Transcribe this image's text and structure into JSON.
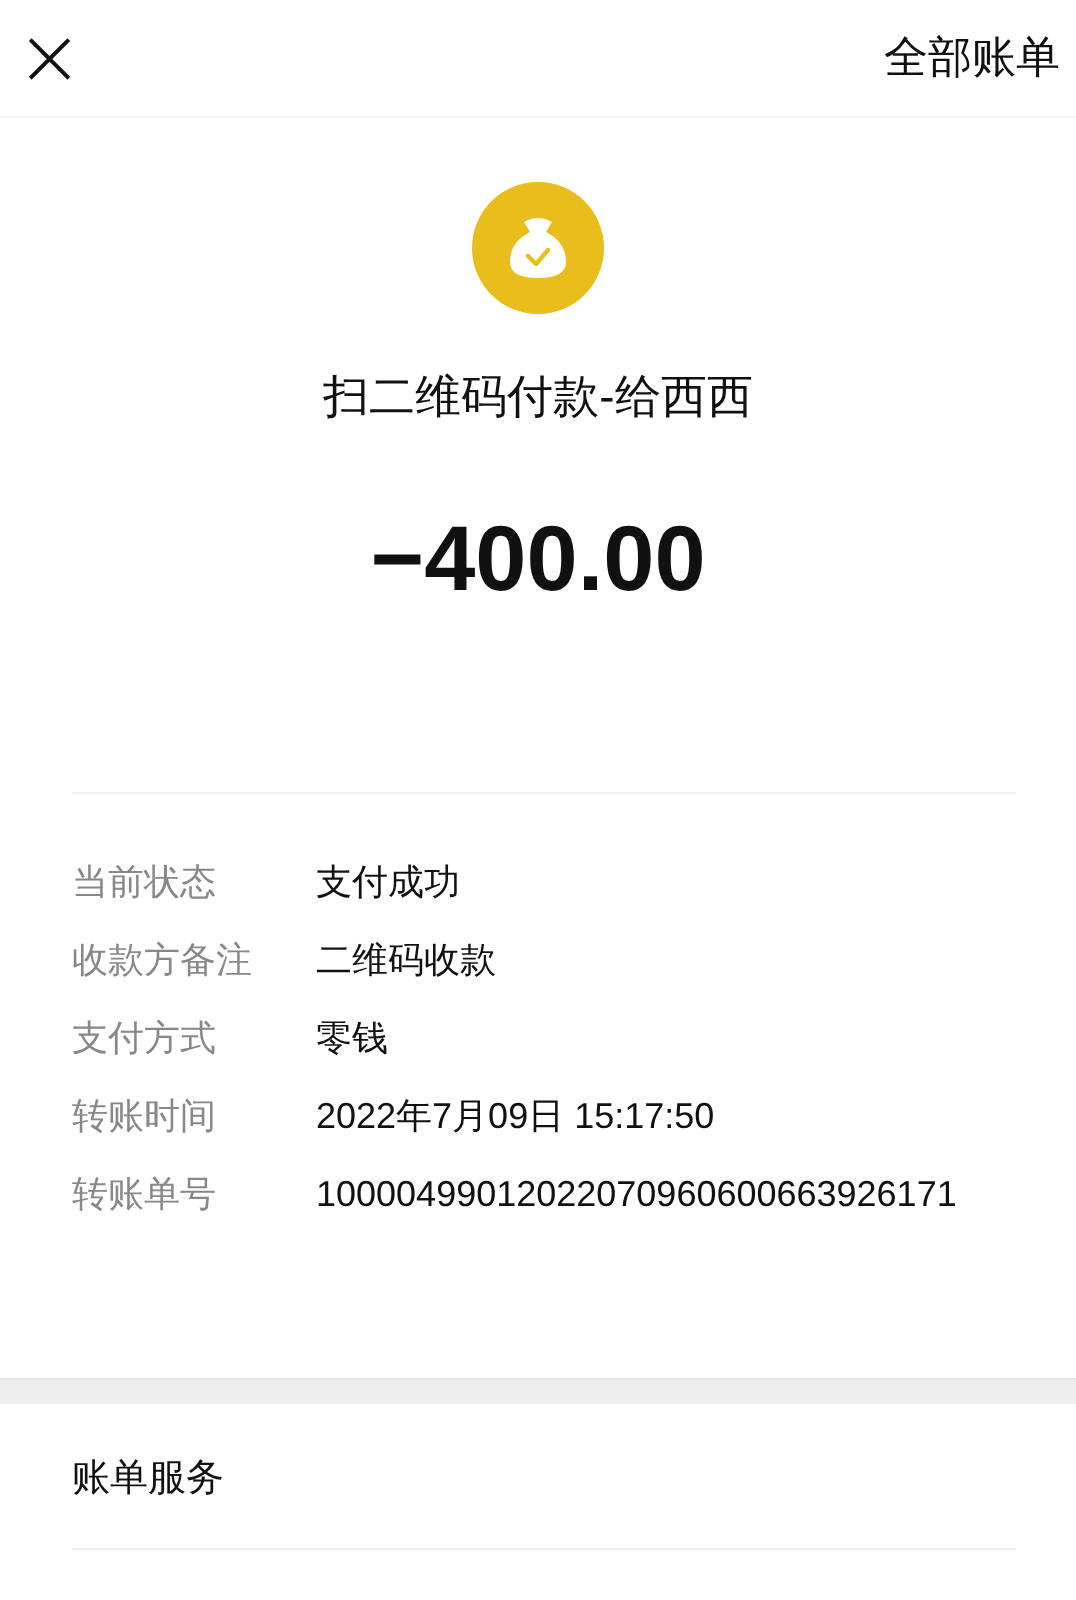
{
  "top_bar": {
    "close": "×",
    "action": "全部账单"
  },
  "payment": {
    "title": "扫二维码付款-给西西",
    "amount": "−400.00"
  },
  "details": [
    {
      "label": "当前状态",
      "value": "支付成功"
    },
    {
      "label": "收款方备注",
      "value": "二维码收款"
    },
    {
      "label": "支付方式",
      "value": "零钱"
    },
    {
      "label": "转账时间",
      "value": "2022年7月09日 15:17:50"
    },
    {
      "label": "转账单号",
      "value": "10000499012022070960600663926171"
    }
  ],
  "services": {
    "title": "账单服务"
  }
}
